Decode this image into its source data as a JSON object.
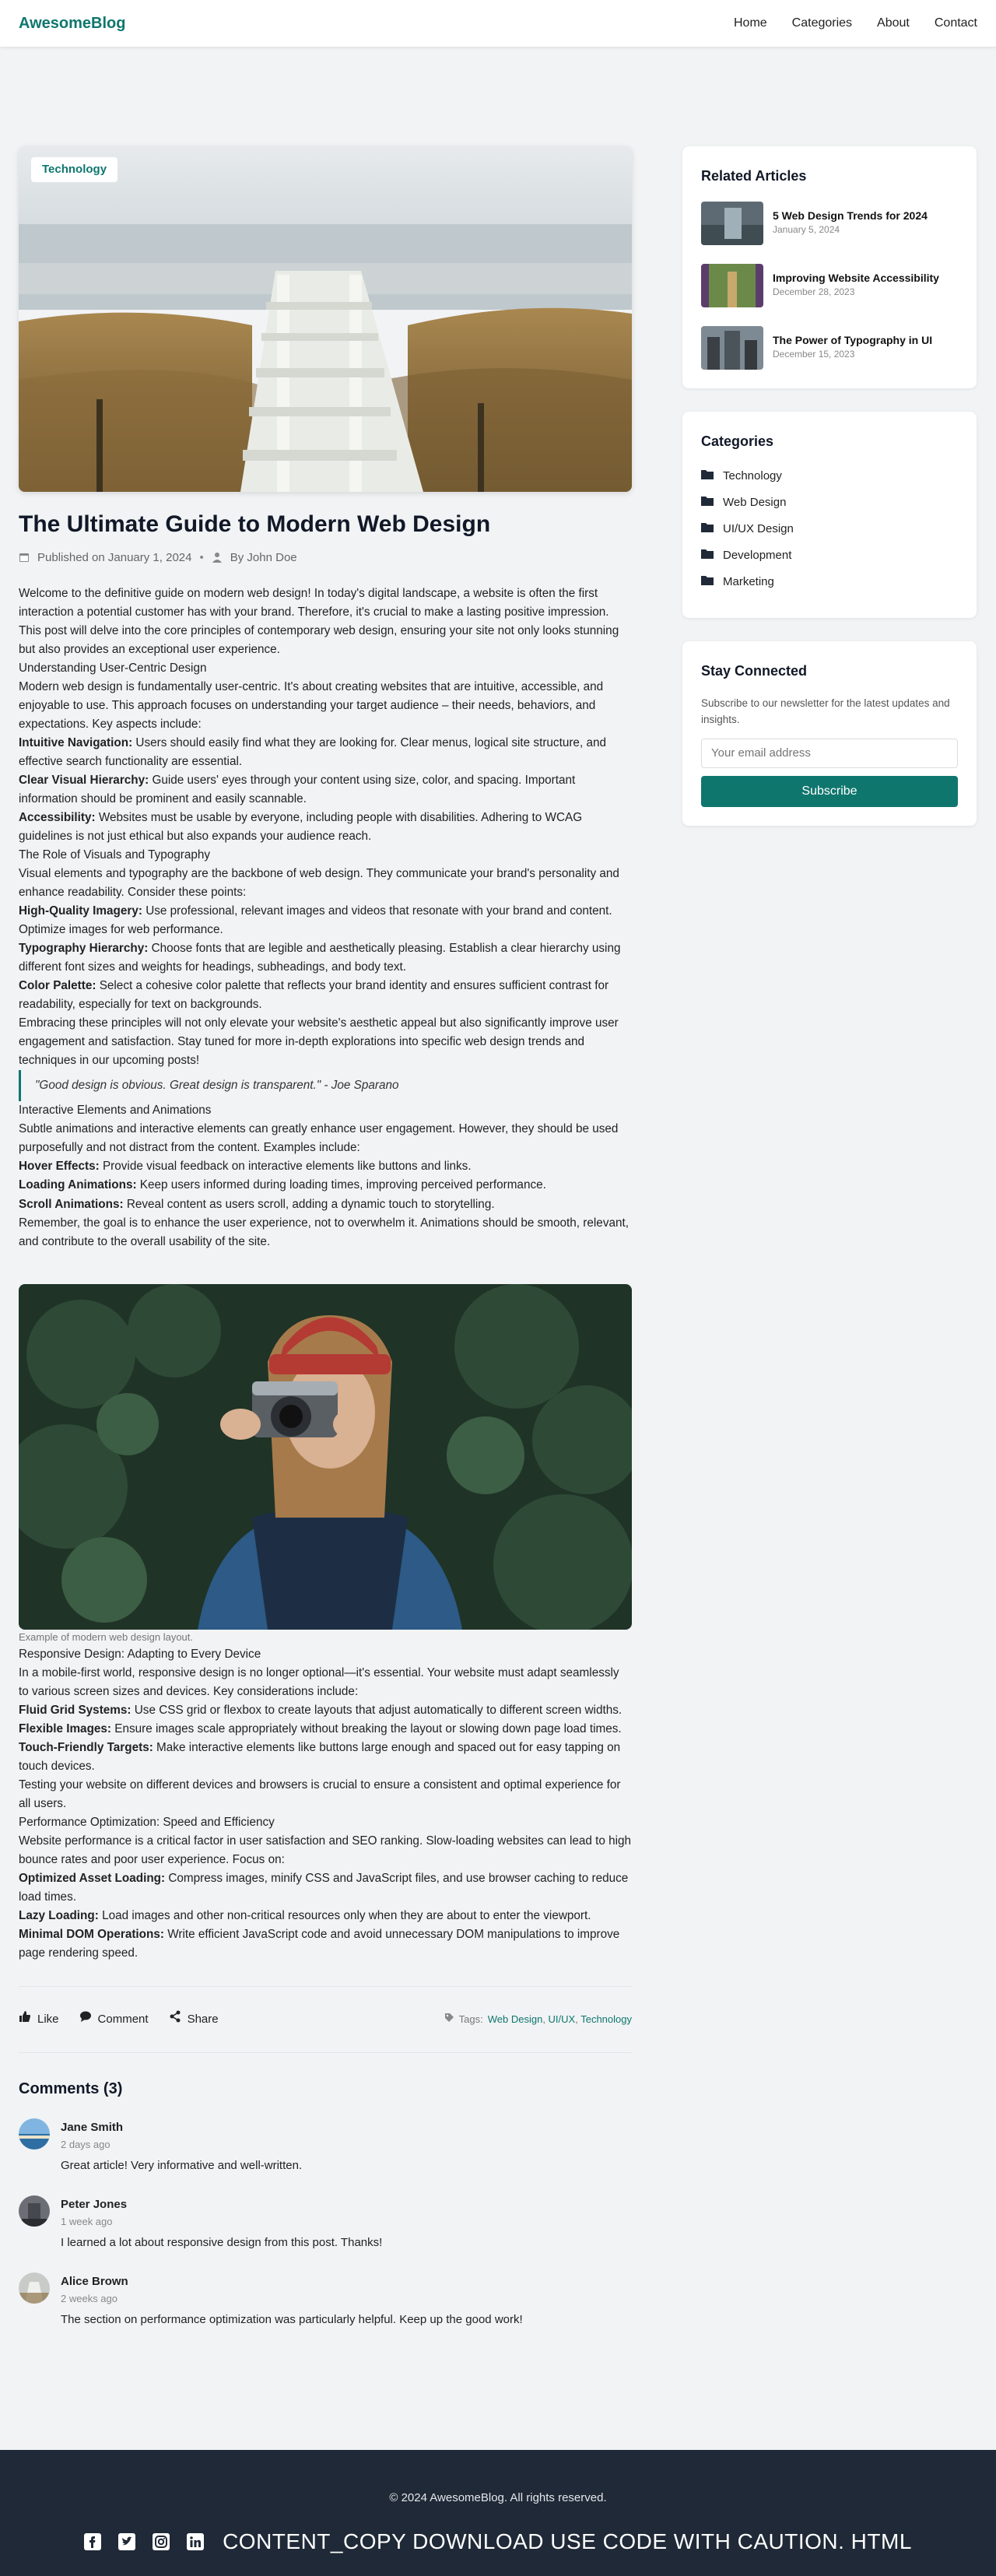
{
  "header": {
    "brand": "AwesomeBlog",
    "nav": [
      "Home",
      "Categories",
      "About",
      "Contact"
    ]
  },
  "post": {
    "category_badge": "Technology",
    "title": "The Ultimate Guide to Modern Web Design",
    "published": "Published on January 1, 2024",
    "author": "By John Doe",
    "intro": "Welcome to the definitive guide on modern web design! In today's digital landscape, a website is often the first interaction a potential customer has with your brand. Therefore, it's crucial to make a lasting positive impression. This post will delve into the core principles of contemporary web design, ensuring your site not only looks stunning but also provides an exceptional user experience.",
    "s1_heading": "Understanding User-Centric Design",
    "s1_text": "Modern web design is fundamentally user-centric. It's about creating websites that are intuitive, accessible, and enjoyable to use. This approach focuses on understanding your target audience – their needs, behaviors, and expectations. Key aspects include:",
    "s1_items": [
      {
        "label": "Intuitive Navigation:",
        "text": " Users should easily find what they are looking for. Clear menus, logical site structure, and effective search functionality are essential."
      },
      {
        "label": "Clear Visual Hierarchy:",
        "text": " Guide users' eyes through your content using size, color, and spacing. Important information should be prominent and easily scannable."
      },
      {
        "label": "Accessibility:",
        "text": " Websites must be usable by everyone, including people with disabilities. Adhering to WCAG guidelines is not just ethical but also expands your audience reach."
      }
    ],
    "s2_heading": "The Role of Visuals and Typography",
    "s2_text": "Visual elements and typography are the backbone of web design. They communicate your brand's personality and enhance readability. Consider these points:",
    "s2_items": [
      {
        "label": "High-Quality Imagery:",
        "text": " Use professional, relevant images and videos that resonate with your brand and content. Optimize images for web performance."
      },
      {
        "label": "Typography Hierarchy:",
        "text": " Choose fonts that are legible and aesthetically pleasing. Establish a clear hierarchy using different font sizes and weights for headings, subheadings, and body text."
      },
      {
        "label": "Color Palette:",
        "text": " Select a cohesive color palette that reflects your brand identity and ensures sufficient contrast for readability, especially for text on backgrounds."
      }
    ],
    "s2_closing": "Embracing these principles will not only elevate your website's aesthetic appeal but also significantly improve user engagement and satisfaction. Stay tuned for more in-depth explorations into specific web design trends and techniques in our upcoming posts!",
    "quote": "\"Good design is obvious. Great design is transparent.\" - Joe Sparano",
    "s3_heading": "Interactive Elements and Animations",
    "s3_text": "Subtle animations and interactive elements can greatly enhance user engagement. However, they should be used purposefully and not distract from the content. Examples include:",
    "s3_items": [
      {
        "label": "Hover Effects:",
        "text": " Provide visual feedback on interactive elements like buttons and links."
      },
      {
        "label": "Loading Animations:",
        "text": " Keep users informed during loading times, improving perceived performance."
      },
      {
        "label": "Scroll Animations:",
        "text": " Reveal content as users scroll, adding a dynamic touch to storytelling."
      }
    ],
    "s3_closing": "Remember, the goal is to enhance the user experience, not to overwhelm it. Animations should be smooth, relevant, and contribute to the overall usability of the site.",
    "photo_caption": "Example of modern web design layout.",
    "s4_heading": "Responsive Design: Adapting to Every Device",
    "s4_text": "In a mobile-first world, responsive design is no longer optional—it's essential. Your website must adapt seamlessly to various screen sizes and devices. Key considerations include:",
    "s4_items": [
      {
        "label": "Fluid Grid Systems:",
        "text": " Use CSS grid or flexbox to create layouts that adjust automatically to different screen widths."
      },
      {
        "label": "Flexible Images:",
        "text": " Ensure images scale appropriately without breaking the layout or slowing down page load times."
      },
      {
        "label": "Touch-Friendly Targets:",
        "text": " Make interactive elements like buttons large enough and spaced out for easy tapping on touch devices."
      }
    ],
    "s4_closing": "Testing your website on different devices and browsers is crucial to ensure a consistent and optimal experience for all users.",
    "s5_heading": "Performance Optimization: Speed and Efficiency",
    "s5_text": "Website performance is a critical factor in user satisfaction and SEO ranking. Slow-loading websites can lead to high bounce rates and poor user experience. Focus on:",
    "s5_items": [
      {
        "label": "Optimized Asset Loading:",
        "text": " Compress images, minify CSS and JavaScript files, and use browser caching to reduce load times."
      },
      {
        "label": "Lazy Loading:",
        "text": " Load images and other non-critical resources only when they are about to enter the viewport."
      },
      {
        "label": "Minimal DOM Operations:",
        "text": " Write efficient JavaScript code and avoid unnecessary DOM manipulations to improve page rendering speed."
      }
    ]
  },
  "actions": {
    "like": "Like",
    "comment": "Comment",
    "share": "Share",
    "tags_label": "Tags:",
    "tags": [
      "Web Design",
      "UI/UX",
      "Technology"
    ]
  },
  "comments": {
    "title": "Comments (3)",
    "items": [
      {
        "name": "Jane Smith",
        "time": "2 days ago",
        "text": "Great article! Very informative and well-written."
      },
      {
        "name": "Peter Jones",
        "time": "1 week ago",
        "text": "I learned a lot about responsive design from this post. Thanks!"
      },
      {
        "name": "Alice Brown",
        "time": "2 weeks ago",
        "text": "The section on performance optimization was particularly helpful. Keep up the good work!"
      }
    ]
  },
  "sidebar": {
    "related_title": "Related Articles",
    "related": [
      {
        "title": "5 Web Design Trends for 2024",
        "date": "January 5, 2024"
      },
      {
        "title": "Improving Website Accessibility",
        "date": "December 28, 2023"
      },
      {
        "title": "The Power of Typography in UI",
        "date": "December 15, 2023"
      }
    ],
    "categories_title": "Categories",
    "categories": [
      "Technology",
      "Web Design",
      "UI/UX Design",
      "Development",
      "Marketing"
    ],
    "newsletter_title": "Stay Connected",
    "newsletter_text": "Subscribe to our newsletter for the latest updates and insights.",
    "email_placeholder": "Your email address",
    "subscribe": "Subscribe"
  },
  "footer": {
    "copyright": "© 2024 AwesomeBlog. All rights reserved.",
    "social_icons": [
      "facebook-icon",
      "twitter-icon",
      "instagram-icon",
      "linkedin-icon"
    ],
    "trailing_text": "CONTENT_COPY DOWNLOAD USE CODE WITH CAUTION. HTML"
  },
  "colors": {
    "accent": "#0f766e",
    "footer_bg": "#1f2937",
    "page_bg": "#f1f3f5"
  }
}
